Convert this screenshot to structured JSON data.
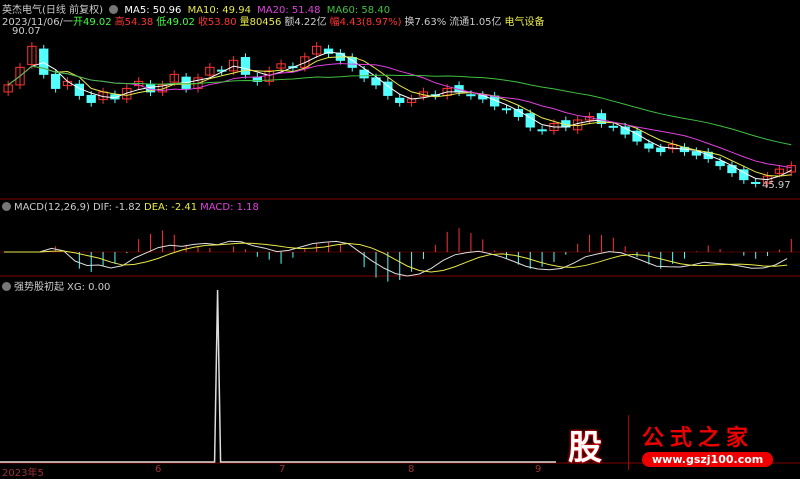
{
  "header": {
    "name": "英杰电气(日线 前复权)",
    "ma5": "MA5: 50.96",
    "ma10": "MA10: 49.94",
    "ma20": "MA20: 51.48",
    "ma60": "MA60: 58.40"
  },
  "quote": {
    "date": "2023/11/06/一",
    "open": "开49.02",
    "high": "高54.38",
    "low": "低49.02",
    "close": "收53.80",
    "volume": "量80456",
    "amount": "额4.22亿",
    "change": "幅4.43(8.97%)",
    "turnover": "换7.63%",
    "float": "流通1.05亿",
    "sector": "电气设备"
  },
  "price_labels": {
    "high": "90.07",
    "low": "45.97"
  },
  "macd": {
    "title": "MACD(12,26,9)",
    "dif": "DIF: -1.82",
    "dea": "DEA: -2.41",
    "macd": "MACD: 1.18"
  },
  "xg": {
    "title": "强势股初起",
    "value": "XG: 0.00"
  },
  "time_axis": [
    "2023年5",
    "6",
    "7",
    "8",
    "9"
  ],
  "watermark": {
    "glyph": "股",
    "title": "公式之家",
    "url": "www.gszj100.com"
  },
  "colors": {
    "up": "#ff3232",
    "down": "#54ffff",
    "ma5": "#ffffff",
    "ma10": "#e8e84a",
    "ma20": "#e040e0",
    "ma60": "#40c040"
  },
  "chart_data": {
    "type": "candlestick",
    "closes": [
      75,
      80,
      86,
      78,
      74,
      76,
      72,
      70,
      73,
      71,
      74,
      76,
      73,
      75,
      78,
      74,
      77,
      80,
      79,
      82,
      78,
      76,
      79,
      81,
      80,
      83,
      86,
      84,
      82,
      80,
      77,
      75,
      72,
      70,
      71,
      73,
      72,
      74,
      73,
      72,
      71,
      69,
      68,
      66,
      63,
      62,
      64,
      63,
      65,
      66,
      64,
      63,
      61,
      59,
      57,
      56,
      58,
      56,
      55,
      54,
      52,
      50,
      48,
      47,
      49,
      51,
      52
    ],
    "xg_signal_index": 18,
    "xg_max": 1
  }
}
